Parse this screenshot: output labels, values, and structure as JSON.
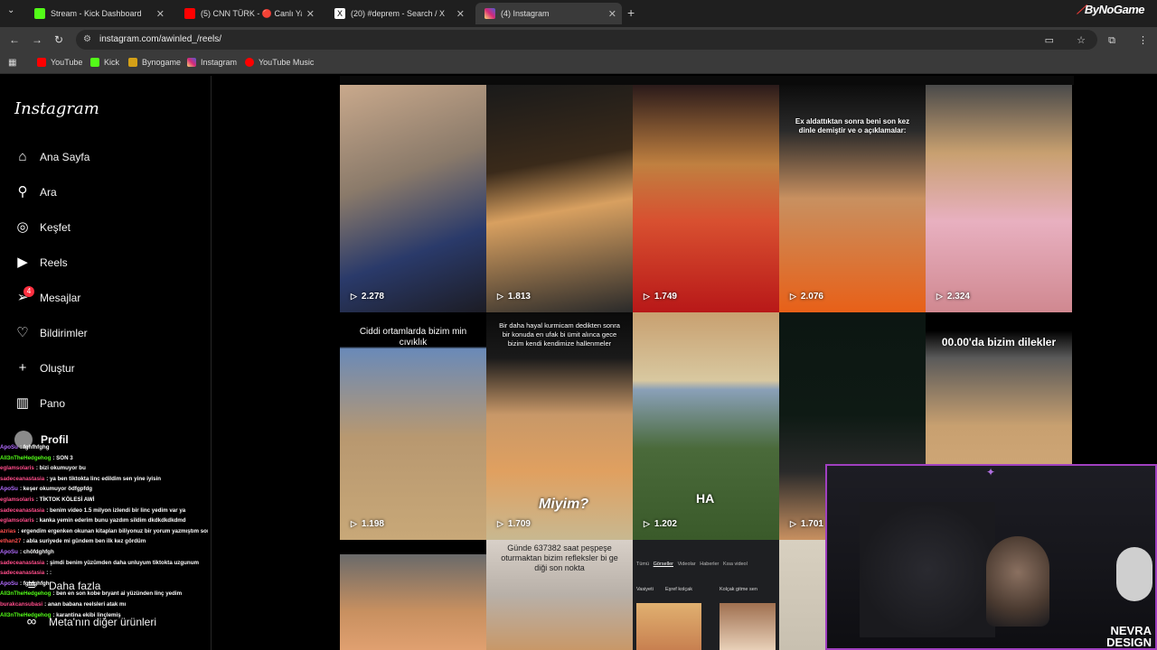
{
  "browser": {
    "tabs": [
      {
        "label": "Stream - Kick Dashboard",
        "color": "#53fc18"
      },
      {
        "label": "(5) CNN TÜRK - 🔴 Canlı Yayın",
        "color": "#ff0000"
      },
      {
        "label": "(20) #deprem - Search / X",
        "color": "#ffffff"
      },
      {
        "label": "(4) Instagram",
        "color": "#e1306c"
      }
    ],
    "url": "instagram.com/awinled_/reels/",
    "brand": "ByNoGame",
    "bookmarks": [
      {
        "label": "YouTube",
        "color": "#ff0000"
      },
      {
        "label": "Kick",
        "color": "#53fc18"
      },
      {
        "label": "Bynogame",
        "color": "#d4a017"
      },
      {
        "label": "Instagram",
        "color": "#e1306c"
      },
      {
        "label": "YouTube Music",
        "color": "#ff0000"
      }
    ]
  },
  "sidebar": {
    "logo": "Instagram",
    "items": [
      {
        "label": "Ana Sayfa",
        "icon": "home-icon"
      },
      {
        "label": "Ara",
        "icon": "search-icon"
      },
      {
        "label": "Keşfet",
        "icon": "compass-icon"
      },
      {
        "label": "Reels",
        "icon": "reels-icon"
      },
      {
        "label": "Mesajlar",
        "icon": "messenger-icon",
        "badge": "4"
      },
      {
        "label": "Bildirimler",
        "icon": "heart-icon"
      },
      {
        "label": "Oluştur",
        "icon": "plus-icon"
      },
      {
        "label": "Pano",
        "icon": "dashboard-icon"
      },
      {
        "label": "Profil",
        "icon": "avatar"
      }
    ],
    "more": "Daha fazla",
    "meta": "Meta'nın diğer ürünleri"
  },
  "chat": [
    {
      "user": "ApoSu",
      "text": "fghfhfghg",
      "color": "#b36bff"
    },
    {
      "user": "All3nTheHedgehog",
      "text": "SON 3",
      "color": "#53fc18"
    },
    {
      "user": "eglamsolaris",
      "text": "bizi okumuyor bu",
      "color": "#ff4d8a"
    },
    {
      "user": "sadeceanastasia",
      "text": "ya ben tiktokta linc edildim sen yine iyisin",
      "color": "#ff4d8a"
    },
    {
      "user": "ApoSu",
      "text": "keşer okumuyor ödfgpfdg",
      "color": "#b36bff"
    },
    {
      "user": "eglamsolaris",
      "text": "TİKTOK KÖLESİ AWİ",
      "color": "#ff4d8a"
    },
    {
      "user": "sadeceanastasia",
      "text": "benim video 1.5 milyon izlendi bir linc yedim var ya",
      "color": "#ff4d8a"
    },
    {
      "user": "eglamsolaris",
      "text": "kanka yemin ederim bunu yazdım sildim dkdkdkdkdmd",
      "color": "#ff4d8a"
    },
    {
      "user": "azrias",
      "text": "ergendim ergenken okunan kitapları biliyonuz bir yorum yazmıştım sonra gel linçler gel",
      "color": "#ff4d4d"
    },
    {
      "user": "ethan27",
      "text": "abla suriyede mi gündem ben ilk kez gördüm",
      "color": "#ff4d4d"
    },
    {
      "user": "ApoSu",
      "text": "chöfdghfgh",
      "color": "#b36bff"
    },
    {
      "user": "sadeceanastasia",
      "text": "şimdi benim yüzümden daha unluyum tiktokta uzgunum",
      "color": "#ff4d8a"
    },
    {
      "user": "sadeceanastasia",
      "text": ":",
      "color": "#ff4d8a"
    },
    {
      "user": "ApoSu",
      "text": "fghfghfgh",
      "color": "#b36bff"
    },
    {
      "user": "All3nTheHedgehog",
      "text": "ben en son kobe bryant ai yüzünden linç yedim",
      "color": "#53fc18"
    },
    {
      "user": "burakcansubasi",
      "text": "anan babana reelsleri atak mı",
      "color": "#ff4d8a"
    },
    {
      "user": "All3nTheHedgehog",
      "text": "karantina ekibi linçlemiş",
      "color": "#53fc18"
    }
  ],
  "reels": [
    {
      "views": "2.278",
      "caption": ""
    },
    {
      "views": "1.813",
      "caption": ""
    },
    {
      "views": "1.749",
      "caption": ""
    },
    {
      "views": "2.076",
      "caption": "Ex aldattıktan sonra beni son kez dinle demiştir ve o açıklamalar:"
    },
    {
      "views": "2.324",
      "caption": ""
    },
    {
      "views": "1.198",
      "caption": "Ciddi ortamlarda bizim min cıvıklık"
    },
    {
      "views": "1.709",
      "caption": "Bir daha hayal kurmicam dedikten sonra bir konuda en ufak bi ümit alınca gece bizim kendi kendimize hallenmeler"
    },
    {
      "views": "1.202",
      "caption": ""
    },
    {
      "views": "1.701",
      "caption": ""
    },
    {
      "views": "",
      "caption": "00.00'da bizim dilekler"
    },
    {
      "views": "",
      "caption": ""
    },
    {
      "views": "",
      "caption": "Günde 637382 saat peşpeşe oturmaktan bizim refleksler bi ge diği son nokta"
    },
    {
      "views": "",
      "caption": ""
    },
    {
      "views": "",
      "caption": ""
    }
  ],
  "overlays": {
    "ha": "HA",
    "miyim": "Miyim?",
    "tile_tabs": [
      "Tümü",
      "Görseller",
      "Videolar",
      "Haberler",
      "Kısa videol"
    ],
    "tile_labels": [
      "Vasiyeti",
      "Eşref kolçak",
      "Kolçak gitme sen"
    ]
  },
  "webcam": {
    "signature": "NEVRA DESIGN"
  }
}
